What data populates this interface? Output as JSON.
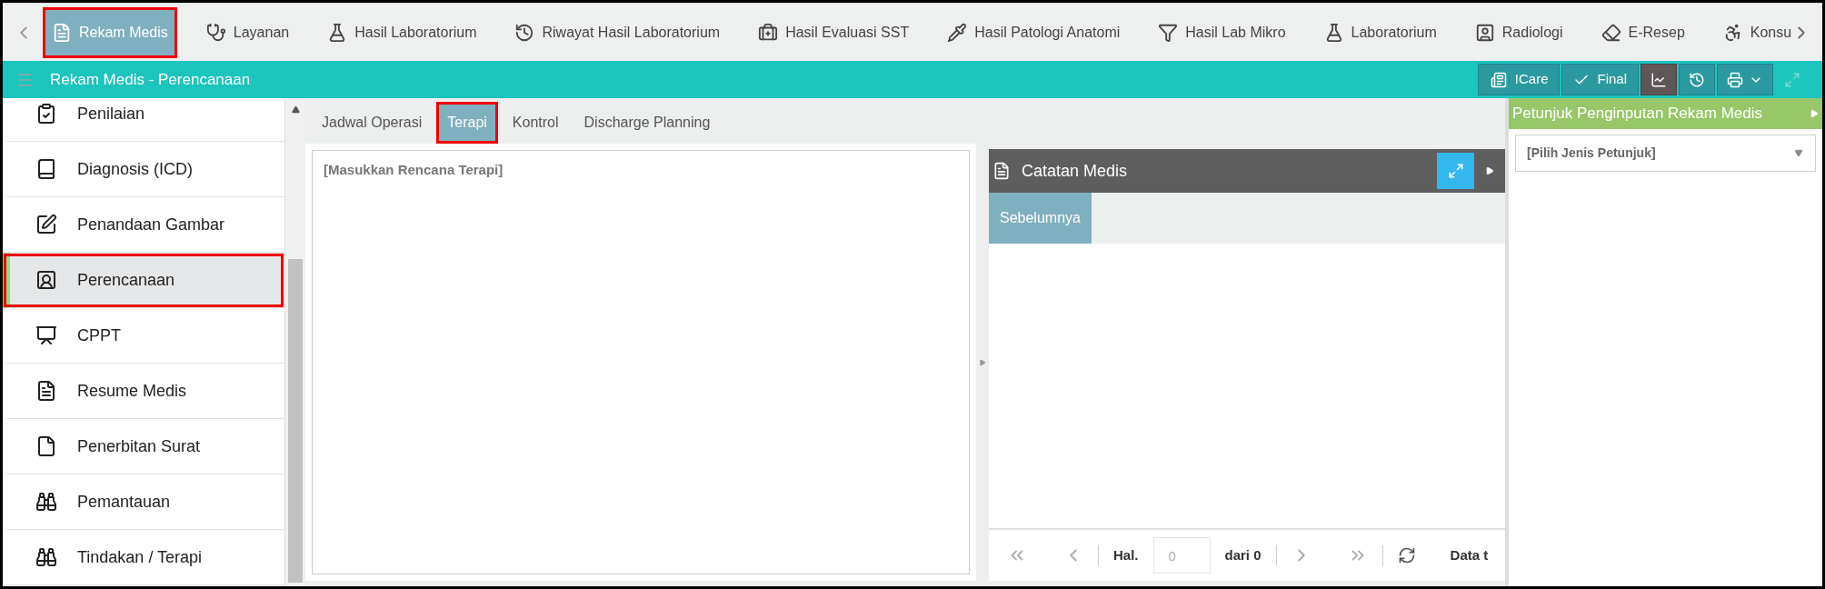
{
  "top_nav": {
    "items": [
      {
        "label": "Rekam Medis",
        "kind": "document",
        "selected": true,
        "highlighted": true
      },
      {
        "label": "Layanan",
        "kind": "doctor",
        "selected": false,
        "highlighted": false
      },
      {
        "label": "Hasil Laboratorium",
        "kind": "flask",
        "selected": false,
        "highlighted": false
      },
      {
        "label": "Riwayat Hasil Laboratorium",
        "kind": "history",
        "selected": false,
        "highlighted": false
      },
      {
        "label": "Hasil Evaluasi SST",
        "kind": "medkit",
        "selected": false,
        "highlighted": false
      },
      {
        "label": "Hasil Patologi Anatomi",
        "kind": "pipette",
        "selected": false,
        "highlighted": false
      },
      {
        "label": "Hasil Lab Mikro",
        "kind": "funnel",
        "selected": false,
        "highlighted": false
      },
      {
        "label": "Laboratorium",
        "kind": "flask",
        "selected": false,
        "highlighted": false
      },
      {
        "label": "Radiologi",
        "kind": "person-square",
        "selected": false,
        "highlighted": false
      },
      {
        "label": "E-Resep",
        "kind": "eraser",
        "selected": false,
        "highlighted": false
      },
      {
        "label": "Konsu",
        "kind": "wheelchair",
        "selected": false,
        "highlighted": false
      }
    ]
  },
  "header": {
    "title": "Rekam Medis - Perencanaan",
    "buttons": [
      {
        "label": "ICare",
        "kind": "card"
      },
      {
        "label": "Final",
        "kind": "check"
      }
    ],
    "icon_buttons": [
      {
        "kind": "chart",
        "selected": true,
        "disabled": false
      },
      {
        "kind": "history",
        "selected": false,
        "disabled": false
      },
      {
        "kind": "print",
        "selected": false,
        "disabled": false
      },
      {
        "kind": "expand",
        "selected": false,
        "disabled": true
      }
    ]
  },
  "sidebar": {
    "items": [
      {
        "label": "Penilaian",
        "kind": "clipboard-check",
        "selected": false,
        "highlighted": false
      },
      {
        "label": "Diagnosis (ICD)",
        "kind": "book",
        "selected": false,
        "highlighted": false
      },
      {
        "label": "Penandaan Gambar",
        "kind": "edit",
        "selected": false,
        "highlighted": false
      },
      {
        "label": "Perencanaan",
        "kind": "planner",
        "selected": true,
        "highlighted": true
      },
      {
        "label": "CPPT",
        "kind": "chart-board",
        "selected": false,
        "highlighted": false
      },
      {
        "label": "Resume Medis",
        "kind": "document",
        "selected": false,
        "highlighted": false
      },
      {
        "label": "Penerbitan Surat",
        "kind": "file",
        "selected": false,
        "highlighted": false
      },
      {
        "label": "Pemantauan",
        "kind": "binoculars",
        "selected": false,
        "highlighted": false
      },
      {
        "label": "Tindakan / Terapi",
        "kind": "binoculars",
        "selected": false,
        "highlighted": false
      }
    ]
  },
  "tabs": [
    {
      "label": "Jadwal Operasi",
      "selected": false,
      "highlighted": false
    },
    {
      "label": "Terapi",
      "selected": true,
      "highlighted": true
    },
    {
      "label": "Kontrol",
      "selected": false,
      "highlighted": false
    },
    {
      "label": "Discharge Planning",
      "selected": false,
      "highlighted": false
    }
  ],
  "therapy_field": {
    "placeholder": "[Masukkan Rencana Terapi]"
  },
  "notes_panel": {
    "title": "Catatan Medis",
    "tabs": [
      {
        "label": "Sebelumnya",
        "selected": true
      }
    ],
    "pager": {
      "page_label": "Hal.",
      "page_value": "0",
      "of_label": "dari 0",
      "info": "Data t"
    }
  },
  "guide_panel": {
    "title": "Petunjuk Penginputan Rekam Medis",
    "select": {
      "placeholder": "[Pilih Jenis Petunjuk]"
    }
  }
}
